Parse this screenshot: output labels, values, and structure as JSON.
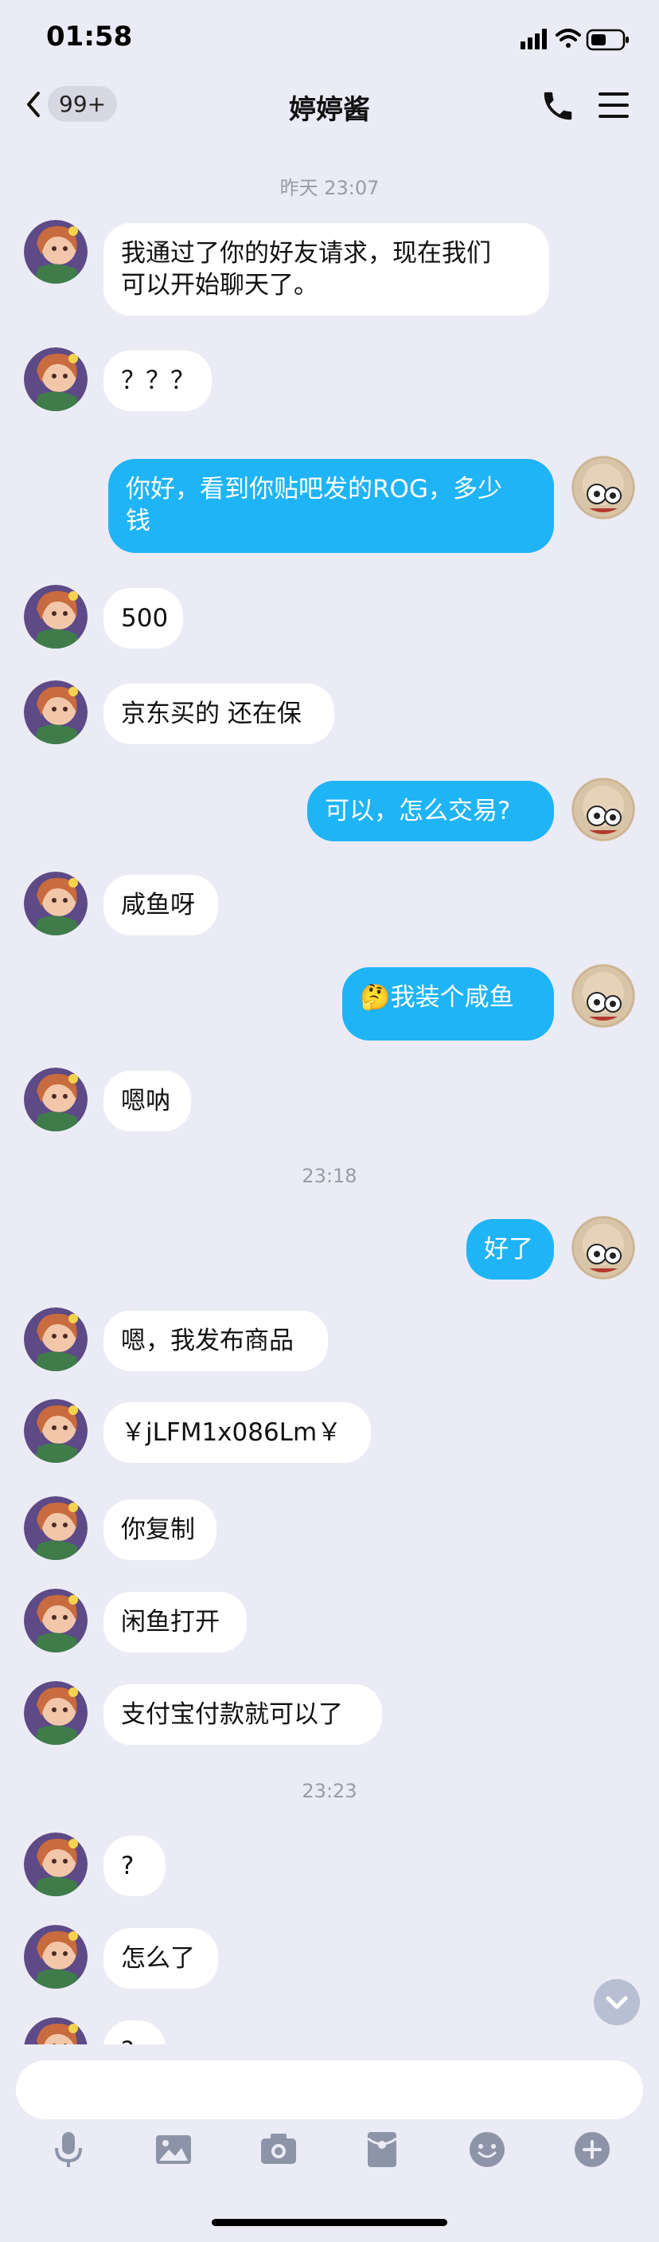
{
  "status_bar": {
    "time": "01:58"
  },
  "header": {
    "back_badge": "99+",
    "title": "婷婷酱"
  },
  "timestamps": [
    "昨天 23:07",
    "23:18",
    "23:23"
  ],
  "messages": [
    {
      "side": "in",
      "text": "我通过了你的好友请求，现在我们\n可以开始聊天了。"
    },
    {
      "side": "in",
      "text": "？？？"
    },
    {
      "side": "out",
      "text": "你好，看到你贴吧发的ROG，多少\n钱"
    },
    {
      "side": "in",
      "text": "500"
    },
    {
      "side": "in",
      "text": "京东买的 还在保"
    },
    {
      "side": "out",
      "text": "可以，怎么交易?"
    },
    {
      "side": "in",
      "text": "咸鱼呀"
    },
    {
      "side": "out",
      "text": "我装个咸鱼",
      "emoji": "🤔"
    },
    {
      "side": "in",
      "text": "嗯呐"
    },
    {
      "side": "out",
      "text": "好了"
    },
    {
      "side": "in",
      "text": "嗯，我发布商品"
    },
    {
      "side": "in",
      "text": "￥jLFM1x086Lm￥"
    },
    {
      "side": "in",
      "text": "你复制"
    },
    {
      "side": "in",
      "text": "闲鱼打开"
    },
    {
      "side": "in",
      "text": "支付宝付款就可以了"
    },
    {
      "side": "in",
      "text": "?"
    },
    {
      "side": "in",
      "text": "怎么了"
    },
    {
      "side": "in",
      "text": "?"
    }
  ],
  "input": {
    "placeholder": ""
  },
  "toolbar": [
    "mic-icon",
    "image-icon",
    "camera-icon",
    "red-packet-icon",
    "emoji-icon",
    "plus-icon"
  ],
  "colors": {
    "out_bubble": "#1fb4f6",
    "in_bubble": "#ffffff",
    "background": "#ebebf5"
  }
}
